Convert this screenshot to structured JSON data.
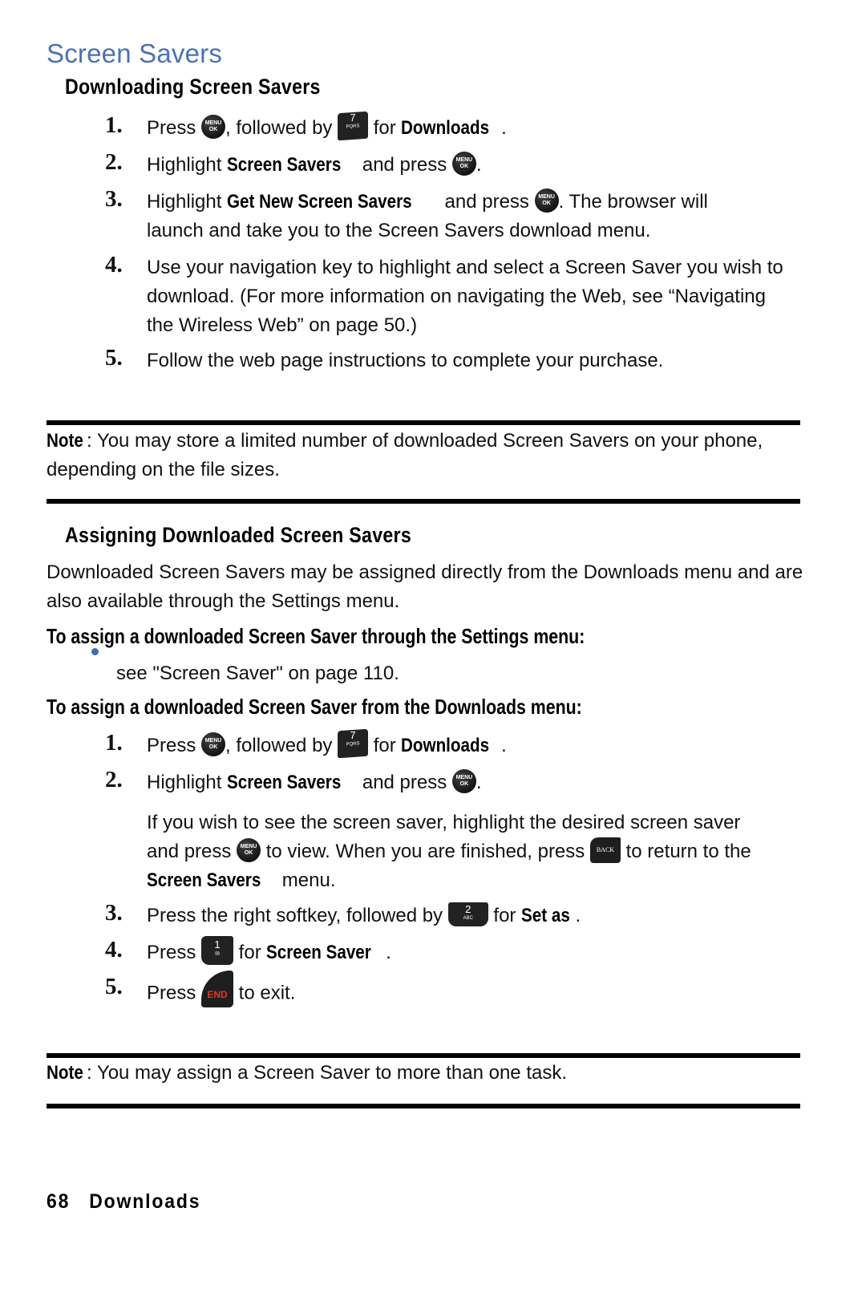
{
  "page_title": "Screen Savers",
  "sections": {
    "downloading": {
      "heading": "Downloading Screen Savers",
      "steps": [
        {
          "num": "1.",
          "t1": "Press ",
          "t2": ", followed by ",
          "t3": " for ",
          "bold": "Downloads",
          "t4": "."
        },
        {
          "num": "2.",
          "t1": "Highlight ",
          "bold": "Screen Savers",
          "t2": " and press ",
          "t3": "."
        },
        {
          "num": "3.",
          "t1": "Highlight ",
          "bold": "Get New Screen Savers",
          "t2": " and press ",
          "t3": ". The browser will",
          "line2": "launch and take you to the Screen Savers download menu."
        },
        {
          "num": "4.",
          "text": "Use your navigation key to highlight and select a Screen Saver you wish to download. (For more information on navigating the Web, see “Navigating the Wireless Web” on page 50.)"
        },
        {
          "num": "5.",
          "text": "Follow the web page instructions to complete your purchase."
        }
      ]
    },
    "note1": {
      "label": "Note",
      "text": ": You may store a limited number of downloaded Screen Savers on your phone, depending on the file sizes."
    },
    "assigning": {
      "heading": "Assigning Downloaded Screen Savers",
      "intro": "Downloaded Screen Savers may be assigned directly from the Downloads menu and are also available through the Settings menu.",
      "settings_heading": "To assign a downloaded Screen Saver through the Settings menu:",
      "settings_bullet": "see \"Screen Saver\" on page 110.",
      "downloads_heading": "To assign a downloaded Screen Saver from the Downloads menu:",
      "steps": [
        {
          "num": "1.",
          "t1": "Press ",
          "t2": ", followed by ",
          "t3": " for ",
          "bold": "Downloads",
          "t4": "."
        },
        {
          "num": "2.",
          "t1": "Highlight ",
          "bold": "Screen Savers",
          "t2": " and press ",
          "t3": "."
        },
        {
          "num": "3.",
          "t1": "Press the right softkey, followed by ",
          "t2": " for ",
          "bold": "Set as",
          "t3": "."
        },
        {
          "num": "4.",
          "t1": "Press ",
          "t2": " for ",
          "bold": "Screen Saver",
          "t3": "."
        },
        {
          "num": "5.",
          "t1": "Press ",
          "t2": " to exit."
        }
      ],
      "sub_para": {
        "line1": "If you wish to see the screen saver, highlight the desired screen saver",
        "t1": "and press ",
        "t2": " to view. When you are finished, press ",
        "t3": " to return to the",
        "bold": "Screen Savers",
        "t4": " menu."
      }
    },
    "note2": {
      "label": "Note",
      "text": ": You may assign a Screen Saver to more than one task."
    }
  },
  "keys": {
    "menu_ok": {
      "icon": "menu-ok-key-icon",
      "line1": "MENU",
      "line2": "OK"
    },
    "seven": {
      "icon": "key-7-icon",
      "digit": "7",
      "letters": "PQRS"
    },
    "two": {
      "icon": "key-2-icon",
      "digit": "2",
      "letters": "ABC"
    },
    "one": {
      "icon": "key-1-icon",
      "digit": "1",
      "letters": "✉"
    },
    "back": {
      "icon": "back-key-icon",
      "label": "BACK"
    },
    "end": {
      "icon": "end-key-icon",
      "label": "END"
    }
  },
  "colors": {
    "title": "#4a72b8",
    "bullet": "#3f6bbd",
    "end_key_text": "#e03a1e"
  },
  "footer": {
    "page_number": "68",
    "section": "Downloads"
  }
}
